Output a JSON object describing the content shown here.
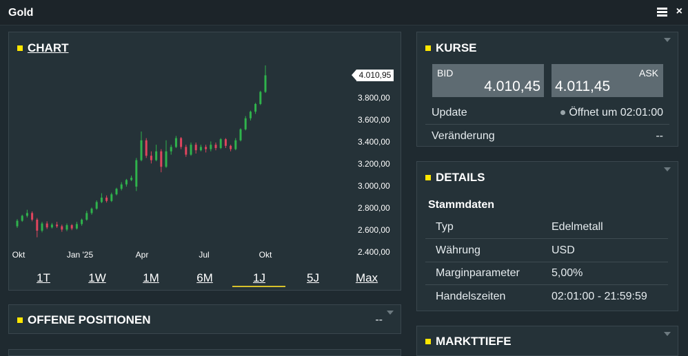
{
  "window": {
    "title": "Gold"
  },
  "chart_panel": {
    "title": "CHART",
    "y_ticks": [
      "3.800,00",
      "3.600,00",
      "3.400,00",
      "3.200,00",
      "3.000,00",
      "2.800,00",
      "2.600,00",
      "2.400,00"
    ],
    "x_ticks": [
      "Okt",
      "Jan '25",
      "Apr",
      "Jul",
      "Okt"
    ],
    "last_price_label": "4.010,95",
    "ranges": [
      "1T",
      "1W",
      "1M",
      "6M",
      "1J",
      "5J",
      "Max"
    ],
    "active_range": "1J",
    "colors": {
      "up": "#2fb34c",
      "down": "#e0455e",
      "range_underline": "#d8c22b"
    }
  },
  "chart_data": {
    "type": "candlestick",
    "title": "",
    "xlabel": "",
    "ylabel": "",
    "ylim": [
      2400,
      4100
    ],
    "x_ticks": [
      "Okt",
      "Jan '25",
      "Apr",
      "Jul",
      "Okt"
    ],
    "last_price": 4010.95,
    "candles": [
      {
        "o": 2640,
        "c": 2690,
        "h": 2705,
        "l": 2625
      },
      {
        "o": 2690,
        "c": 2735,
        "h": 2745,
        "l": 2680
      },
      {
        "o": 2735,
        "c": 2760,
        "h": 2790,
        "l": 2720
      },
      {
        "o": 2760,
        "c": 2700,
        "h": 2775,
        "l": 2685
      },
      {
        "o": 2700,
        "c": 2600,
        "h": 2715,
        "l": 2540
      },
      {
        "o": 2600,
        "c": 2665,
        "h": 2680,
        "l": 2585
      },
      {
        "o": 2665,
        "c": 2630,
        "h": 2685,
        "l": 2615
      },
      {
        "o": 2630,
        "c": 2655,
        "h": 2670,
        "l": 2620
      },
      {
        "o": 2655,
        "c": 2640,
        "h": 2680,
        "l": 2625
      },
      {
        "o": 2640,
        "c": 2610,
        "h": 2655,
        "l": 2590
      },
      {
        "o": 2610,
        "c": 2650,
        "h": 2665,
        "l": 2595
      },
      {
        "o": 2650,
        "c": 2620,
        "h": 2660,
        "l": 2605
      },
      {
        "o": 2620,
        "c": 2660,
        "h": 2680,
        "l": 2610
      },
      {
        "o": 2660,
        "c": 2700,
        "h": 2710,
        "l": 2645
      },
      {
        "o": 2700,
        "c": 2760,
        "h": 2780,
        "l": 2690
      },
      {
        "o": 2760,
        "c": 2800,
        "h": 2810,
        "l": 2745
      },
      {
        "o": 2800,
        "c": 2860,
        "h": 2875,
        "l": 2790
      },
      {
        "o": 2860,
        "c": 2900,
        "h": 2940,
        "l": 2850
      },
      {
        "o": 2900,
        "c": 2870,
        "h": 2920,
        "l": 2855
      },
      {
        "o": 2870,
        "c": 2930,
        "h": 2945,
        "l": 2860
      },
      {
        "o": 2930,
        "c": 2980,
        "h": 2990,
        "l": 2920
      },
      {
        "o": 2980,
        "c": 3020,
        "h": 3040,
        "l": 2965
      },
      {
        "o": 3020,
        "c": 3060,
        "h": 3070,
        "l": 3000
      },
      {
        "o": 3060,
        "c": 3080,
        "h": 3100,
        "l": 3050
      },
      {
        "o": 3000,
        "c": 3240,
        "h": 3260,
        "l": 2960
      },
      {
        "o": 3240,
        "c": 3420,
        "h": 3500,
        "l": 3230
      },
      {
        "o": 3420,
        "c": 3280,
        "h": 3440,
        "l": 3260
      },
      {
        "o": 3280,
        "c": 3240,
        "h": 3320,
        "l": 3210
      },
      {
        "o": 3240,
        "c": 3320,
        "h": 3380,
        "l": 3230
      },
      {
        "o": 3320,
        "c": 3180,
        "h": 3340,
        "l": 3130
      },
      {
        "o": 3180,
        "c": 3320,
        "h": 3420,
        "l": 3170
      },
      {
        "o": 3320,
        "c": 3360,
        "h": 3380,
        "l": 3290
      },
      {
        "o": 3360,
        "c": 3440,
        "h": 3460,
        "l": 3350
      },
      {
        "o": 3440,
        "c": 3360,
        "h": 3450,
        "l": 3340
      },
      {
        "o": 3360,
        "c": 3290,
        "h": 3380,
        "l": 3270
      },
      {
        "o": 3290,
        "c": 3380,
        "h": 3400,
        "l": 3280
      },
      {
        "o": 3380,
        "c": 3330,
        "h": 3400,
        "l": 3300
      },
      {
        "o": 3330,
        "c": 3360,
        "h": 3380,
        "l": 3320
      },
      {
        "o": 3360,
        "c": 3340,
        "h": 3380,
        "l": 3310
      },
      {
        "o": 3340,
        "c": 3380,
        "h": 3410,
        "l": 3320
      },
      {
        "o": 3380,
        "c": 3350,
        "h": 3400,
        "l": 3330
      },
      {
        "o": 3350,
        "c": 3430,
        "h": 3440,
        "l": 3340
      },
      {
        "o": 3430,
        "c": 3370,
        "h": 3440,
        "l": 3350
      },
      {
        "o": 3370,
        "c": 3340,
        "h": 3380,
        "l": 3320
      },
      {
        "o": 3340,
        "c": 3420,
        "h": 3440,
        "l": 3330
      },
      {
        "o": 3420,
        "c": 3520,
        "h": 3530,
        "l": 3410
      },
      {
        "o": 3520,
        "c": 3620,
        "h": 3640,
        "l": 3510
      },
      {
        "o": 3620,
        "c": 3680,
        "h": 3690,
        "l": 3600
      },
      {
        "o": 3680,
        "c": 3750,
        "h": 3760,
        "l": 3660
      },
      {
        "o": 3750,
        "c": 3860,
        "h": 3870,
        "l": 3740
      },
      {
        "o": 3860,
        "c": 4010,
        "h": 4100,
        "l": 3850
      }
    ]
  },
  "kurse_panel": {
    "title": "KURSE",
    "bid_label": "BID",
    "bid_value": "4.010,45",
    "ask_label": "ASK",
    "ask_value": "4.011,45",
    "update_label": "Update",
    "update_value": "Öffnet um 02:01:00",
    "change_label": "Veränderung",
    "change_value": "--"
  },
  "details_panel": {
    "title": "DETAILS",
    "section": "Stammdaten",
    "rows": [
      {
        "label": "Typ",
        "value": "Edelmetall"
      },
      {
        "label": "Währung",
        "value": "USD"
      },
      {
        "label": "Marginparameter",
        "value": "5,00%"
      },
      {
        "label": "Handelszeiten",
        "value": "02:01:00 - 21:59:59"
      }
    ]
  },
  "positionen_panel": {
    "title": "OFFENE POSITIONEN",
    "value": "--"
  },
  "markttiefe_panel": {
    "title": "MARKTTIEFE"
  }
}
